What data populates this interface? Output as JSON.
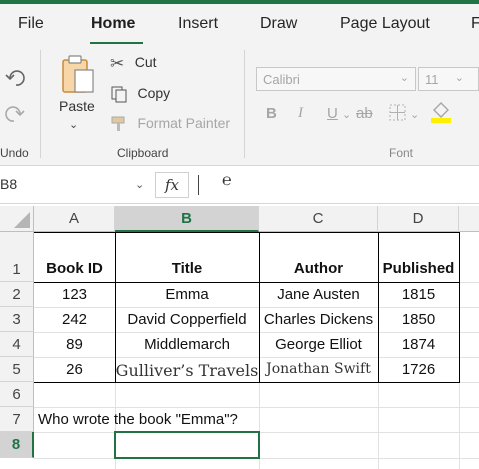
{
  "tabs": [
    {
      "label": "File"
    },
    {
      "label": "Home",
      "active": true
    },
    {
      "label": "Insert"
    },
    {
      "label": "Draw"
    },
    {
      "label": "Page Layout"
    },
    {
      "label": "F"
    }
  ],
  "ribbon": {
    "undo_label": "Undo",
    "paste_label": "Paste",
    "cut_label": "Cut",
    "copy_label": "Copy",
    "format_painter_label": "Format Painter",
    "clipboard_group_label": "Clipboard",
    "font_name": "Calibri",
    "font_size": "11",
    "bold": "B",
    "italic": "I",
    "underline": "U",
    "strike": "ab",
    "font_group_label": "Font"
  },
  "formula_bar": {
    "name_box": "B8",
    "fx_label": "fx",
    "formula": ""
  },
  "grid": {
    "columns": [
      "A",
      "B",
      "C",
      "D"
    ],
    "selected_column": "B",
    "rows": [
      "1",
      "2",
      "3",
      "4",
      "5",
      "6",
      "7",
      "8"
    ],
    "selected_row": "8",
    "table_headers": [
      "Book ID",
      "Title",
      "Author",
      "Published"
    ],
    "table_rows": [
      [
        "123",
        "Emma",
        "Jane Austen",
        "1815"
      ],
      [
        "242",
        "David Copperfield",
        "Charles Dickens",
        "1850"
      ],
      [
        "89",
        "Middlemarch",
        "George Elliot",
        "1874"
      ],
      [
        "26",
        "Gulliver’s Travels",
        "Jonathan Swift",
        "1726"
      ]
    ],
    "question": "Who wrote the book \"Emma\"?",
    "active_cell": "B8"
  },
  "colors": {
    "accent": "#217346",
    "ribbon_bg": "#f3f3f3"
  }
}
